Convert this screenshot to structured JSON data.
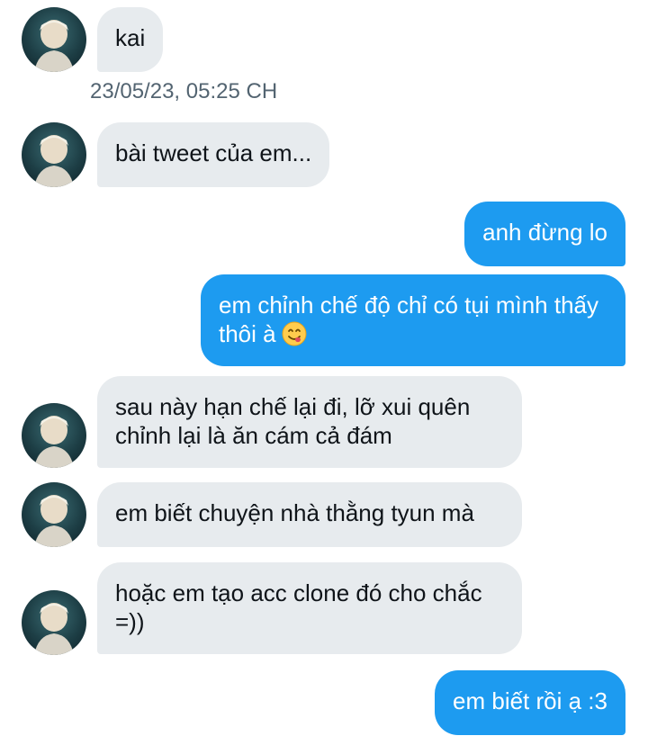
{
  "conversation": {
    "messages": [
      {
        "sender": "other",
        "text": "kai"
      },
      {
        "sender": "other",
        "text": "bài tweet của em..."
      },
      {
        "sender": "me",
        "text": "anh đừng lo"
      },
      {
        "sender": "me",
        "text": "em chỉnh chế độ chỉ có tụi mình thấy thôi à",
        "emoji": "face-savoring-food-emoji"
      },
      {
        "sender": "other",
        "text": "sau này hạn chế lại đi, lỡ xui quên chỉnh lại là ăn cám cả đám"
      },
      {
        "sender": "other",
        "text": "em biết chuyện nhà thằng tyun mà"
      },
      {
        "sender": "other",
        "text": "hoặc em tạo acc clone đó cho chắc =))"
      },
      {
        "sender": "me",
        "text": "em biết rồi ạ :3"
      }
    ],
    "timestamp": "23/05/23, 05:25 CH"
  },
  "colors": {
    "incoming_bubble": "#e7ebee",
    "outgoing_bubble": "#1d9bf0",
    "timestamp_text": "#536471"
  }
}
